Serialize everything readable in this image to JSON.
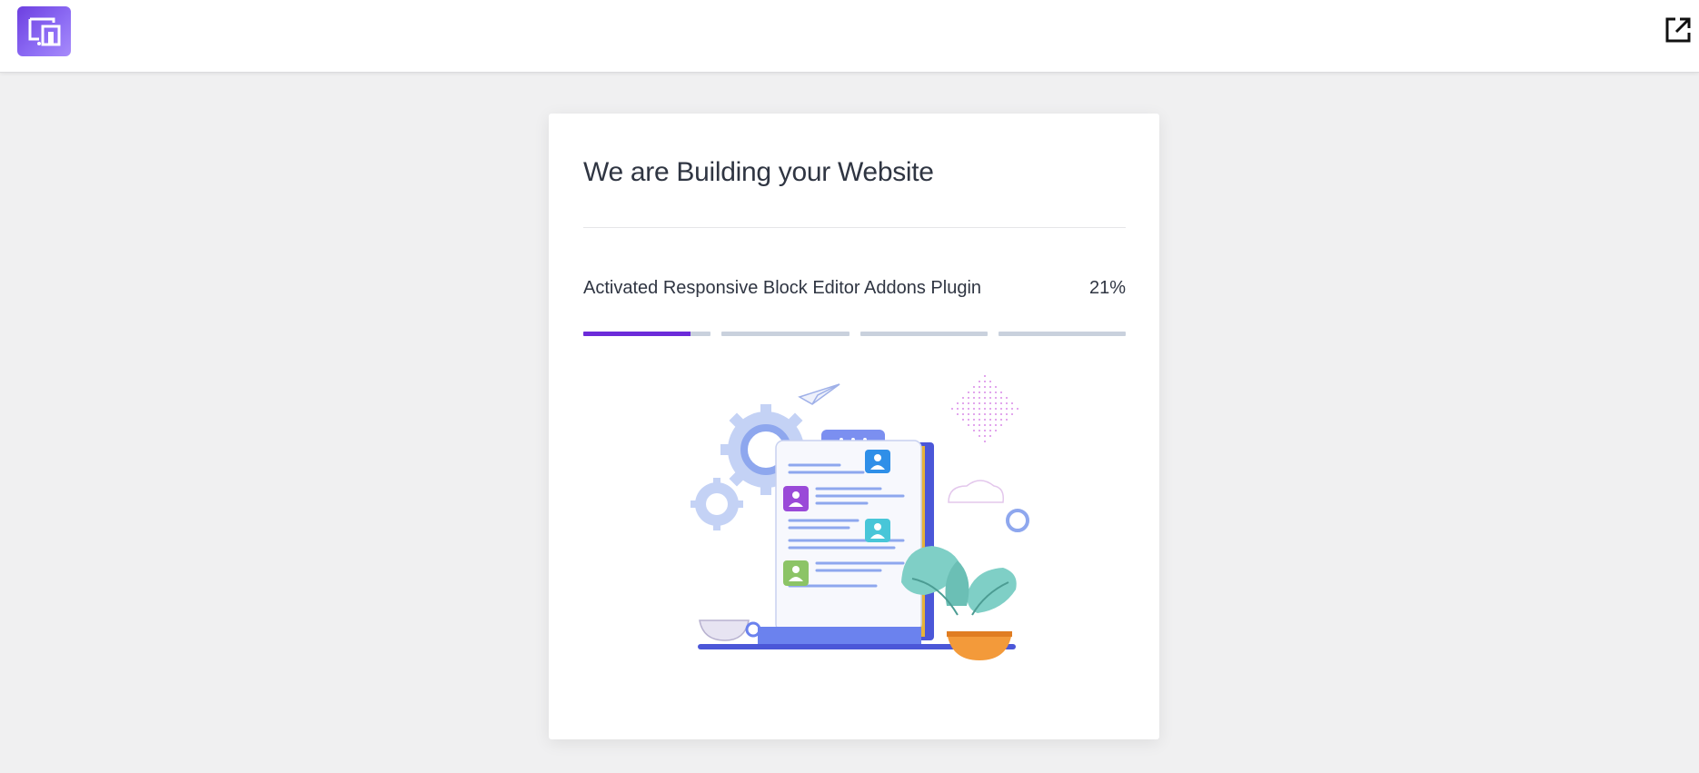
{
  "header": {
    "logo_icon": "devices-icon",
    "exit_icon": "external-link-icon"
  },
  "card": {
    "title": "We are Building your Website",
    "status_text": "Activated Responsive Block Editor Addons Plugin",
    "percent_text": "21%"
  },
  "progress": {
    "segments": [
      {
        "fill": 0.84
      },
      {
        "fill": 0
      },
      {
        "fill": 0
      },
      {
        "fill": 0
      }
    ],
    "fill_color": "#6c2bd9",
    "track_color": "#c9d1dd"
  },
  "colors": {
    "accent": "#6c2bd9",
    "background": "#f0f0f1",
    "text": "#2f3542"
  }
}
